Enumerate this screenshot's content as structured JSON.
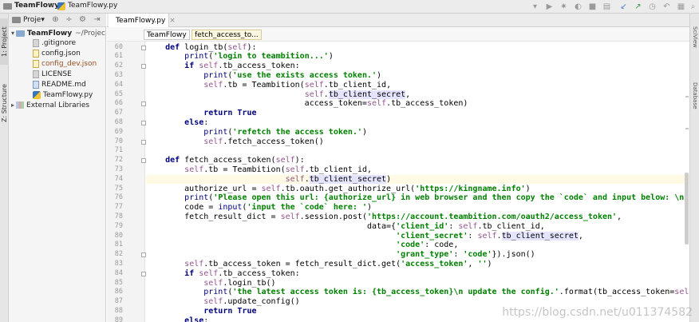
{
  "navbar": {
    "project_name": "TeamFlowy",
    "file_name": "TeamFlowy.py"
  },
  "left_strip": {
    "project_tab": "1: Project",
    "structure_tab": "Z: Structure"
  },
  "right_strip": {
    "sciview_tab": "SciView",
    "database_tab": "Database"
  },
  "project_panel": {
    "dropdown_label": "Proje▾",
    "root": {
      "name": "TeamFlowy",
      "path": "~/Projec"
    },
    "files": [
      {
        "name": ".gitignore",
        "type": "file"
      },
      {
        "name": "config.json",
        "type": "json"
      },
      {
        "name": "config_dev.json",
        "type": "json"
      },
      {
        "name": "LICENSE",
        "type": "file"
      },
      {
        "name": "README.md",
        "type": "md"
      },
      {
        "name": "TeamFlowy.py",
        "type": "py"
      }
    ],
    "external": "External Libraries"
  },
  "editor": {
    "tab_label": "TeamFlowy.py",
    "breadcrumbs": [
      "TeamFlowy",
      "fetch_access_to..."
    ],
    "highlight_line": 74,
    "lines": [
      {
        "n": 60,
        "text": "    def login_tb(self):"
      },
      {
        "n": 61,
        "text": "        print('login to teambition...')"
      },
      {
        "n": 62,
        "text": "        if self.tb_access_token:"
      },
      {
        "n": 63,
        "text": "            print('use the exists access token.')"
      },
      {
        "n": 64,
        "text": "            self.tb = Teambition(self.tb_client_id,"
      },
      {
        "n": 65,
        "text": "                                 self.tb_client_secret,"
      },
      {
        "n": 66,
        "text": "                                 access_token=self.tb_access_token)"
      },
      {
        "n": 67,
        "text": "            return True"
      },
      {
        "n": 68,
        "text": "        else:"
      },
      {
        "n": 69,
        "text": "            print('refetch the access token.')"
      },
      {
        "n": 70,
        "text": "            self.fetch_access_token()"
      },
      {
        "n": 71,
        "text": ""
      },
      {
        "n": 72,
        "text": "    def fetch_access_token(self):"
      },
      {
        "n": 73,
        "text": "        self.tb = Teambition(self.tb_client_id,"
      },
      {
        "n": 74,
        "text": "                             self.tb_client_secret)"
      },
      {
        "n": 75,
        "text": "        authorize_url = self.tb.oauth.get_authorize_url('https://kingname.info')"
      },
      {
        "n": 76,
        "text": "        print('Please open this url: {authorize_url} in web browser and then copy the `code` and input below: \\n'.format(aut"
      },
      {
        "n": 77,
        "text": "        code = input('input the `code` here: ')"
      },
      {
        "n": 78,
        "text": "        fetch_result_dict = self.session.post('https://account.teambition.com/oauth2/access_token',"
      },
      {
        "n": 79,
        "text": "                                              data={'client_id': self.tb_client_id,"
      },
      {
        "n": 80,
        "text": "                                                    'client_secret': self.tb_client_secret,"
      },
      {
        "n": 81,
        "text": "                                                    'code': code,"
      },
      {
        "n": 82,
        "text": "                                                    'grant_type': 'code'}).json()"
      },
      {
        "n": 83,
        "text": "        self.tb_access_token = fetch_result_dict.get('access_token', '')"
      },
      {
        "n": 84,
        "text": "        if self.tb_access_token:"
      },
      {
        "n": 85,
        "text": "            self.login_tb()"
      },
      {
        "n": 86,
        "text": "            print('the latest access token is: {tb_access_token}\\n update the config.'.format(tb_access_token=self.tb_access"
      },
      {
        "n": 87,
        "text": "            self.update_config()"
      },
      {
        "n": 88,
        "text": "            return True"
      },
      {
        "n": 89,
        "text": "        else:"
      }
    ]
  },
  "watermark": "https://blog.csdn.net/u011374582",
  "colors": {
    "keyword": "#000080",
    "string": "#008000",
    "self": "#94558d",
    "builtin": "#000080",
    "line_highlight": "#fffae3",
    "identifier_usage": "#e4e4ff"
  }
}
